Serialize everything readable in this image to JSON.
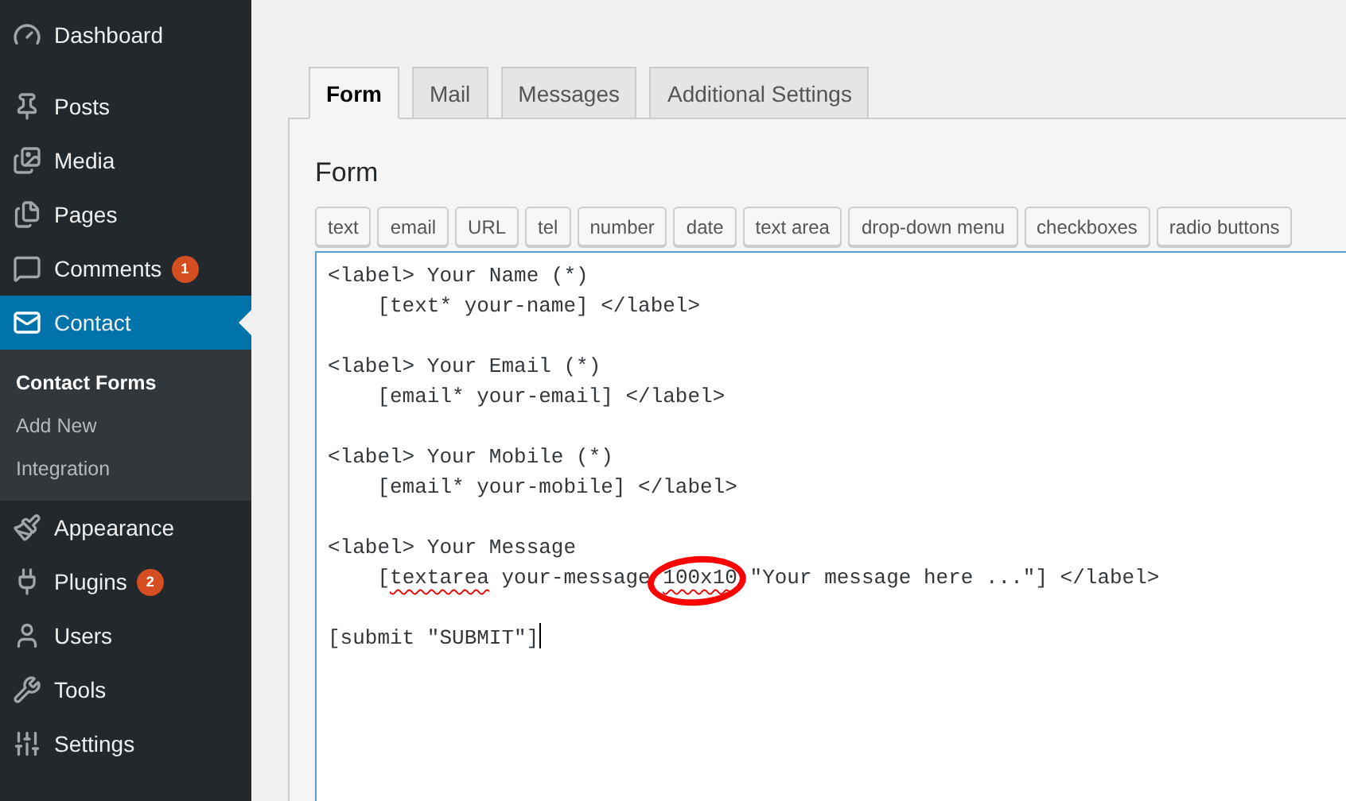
{
  "sidebar": {
    "groups": [
      {
        "items": [
          {
            "label": "Dashboard",
            "selected": false
          }
        ]
      },
      {
        "items": [
          {
            "label": "Posts",
            "selected": false
          },
          {
            "label": "Media",
            "selected": false
          },
          {
            "label": "Pages",
            "selected": false
          },
          {
            "label": "Comments",
            "selected": false,
            "badge": "1"
          },
          {
            "label": "Contact",
            "selected": true,
            "children": [
              {
                "label": "Contact Forms",
                "selected": true
              },
              {
                "label": "Add New",
                "selected": false
              },
              {
                "label": "Integration",
                "selected": false
              }
            ]
          },
          {
            "label": "Appearance",
            "selected": false
          },
          {
            "label": "Plugins",
            "selected": false,
            "badge": "2"
          },
          {
            "label": "Users",
            "selected": false
          },
          {
            "label": "Tools",
            "selected": false
          },
          {
            "label": "Settings",
            "selected": false
          }
        ]
      }
    ]
  },
  "tabs": [
    {
      "label": "Form",
      "selected": true
    },
    {
      "label": "Mail",
      "selected": false
    },
    {
      "label": "Messages",
      "selected": false
    },
    {
      "label": "Additional Settings",
      "selected": false
    }
  ],
  "panel": {
    "heading": "Form",
    "tag_buttons": [
      "text",
      "email",
      "URL",
      "tel",
      "number",
      "date",
      "text area",
      "drop-down menu",
      "checkboxes",
      "radio buttons"
    ],
    "template": {
      "blocks": [
        [
          [
            {
              "text": "<label> Your Name (*)",
              "spelling_error": false,
              "circled": false
            }
          ],
          [
            {
              "text": "    [text* your-name] </label>",
              "spelling_error": false,
              "circled": false
            }
          ]
        ],
        [
          [
            {
              "text": "<label> Your Email (*)",
              "spelling_error": false,
              "circled": false
            }
          ],
          [
            {
              "text": "    [email* your-email] </label>",
              "spelling_error": false,
              "circled": false
            }
          ]
        ],
        [
          [
            {
              "text": "<label> Your Mobile (*)",
              "spelling_error": false,
              "circled": false
            }
          ],
          [
            {
              "text": "    [email* your-mobile] </label>",
              "spelling_error": false,
              "circled": false
            }
          ]
        ],
        [
          [
            {
              "text": "<label> Your Message",
              "spelling_error": false,
              "circled": false
            }
          ],
          [
            {
              "text": "    [",
              "spelling_error": false,
              "circled": false
            },
            {
              "text": "textarea",
              "spelling_error": true,
              "circled": false
            },
            {
              "text": " your-message ",
              "spelling_error": false,
              "circled": false
            },
            {
              "text": "100x10",
              "spelling_error": true,
              "circled": true
            },
            {
              "text": " \"Your message here ...\"] </label>",
              "spelling_error": false,
              "circled": false
            }
          ]
        ],
        [
          [
            {
              "text": "[submit \"SUBMIT\"]",
              "spelling_error": false,
              "circled": false
            }
          ]
        ]
      ],
      "cursor": true
    }
  }
}
